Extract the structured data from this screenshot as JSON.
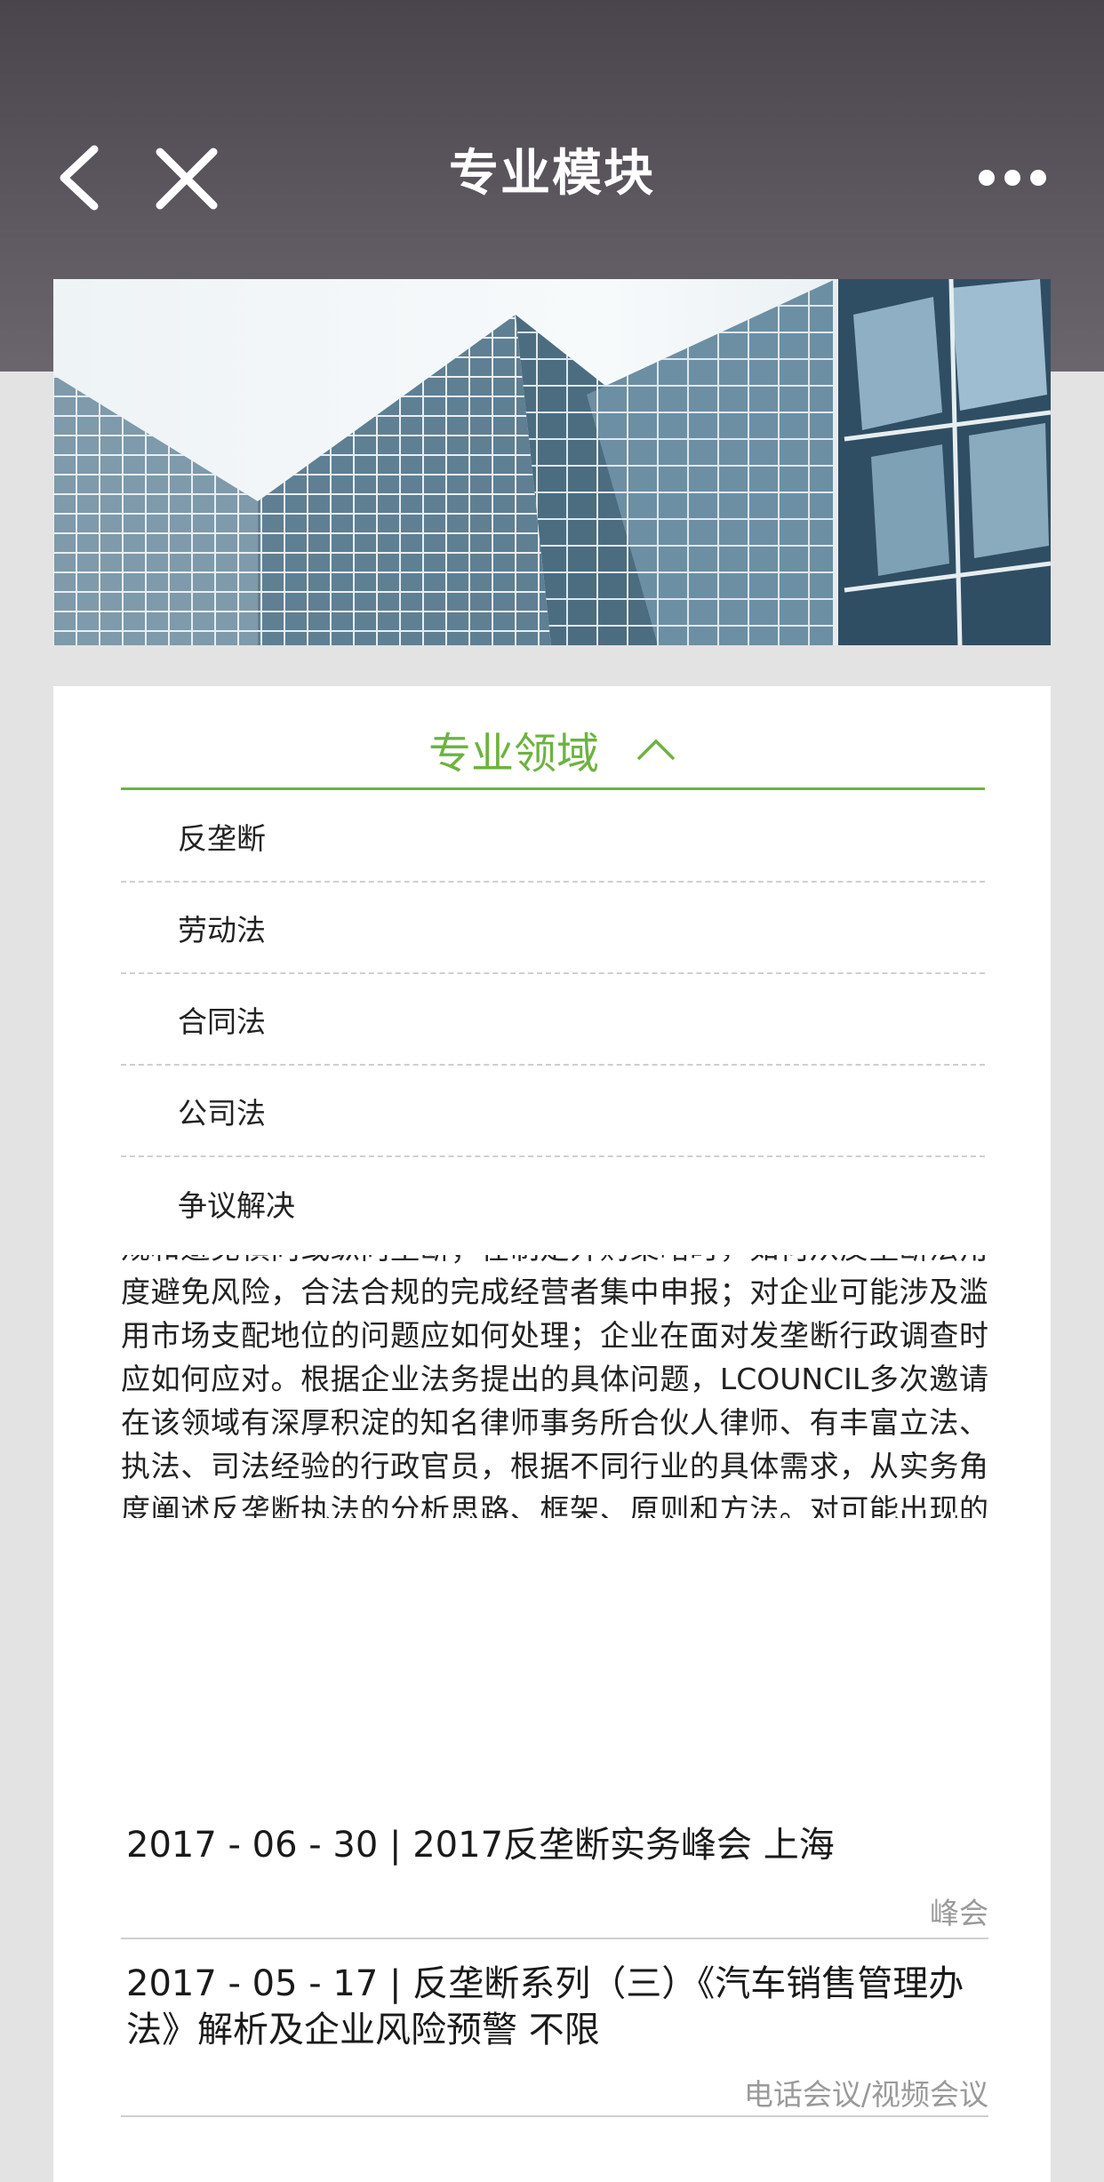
{
  "header": {
    "title": "专业模块"
  },
  "section": {
    "title": "专业领域",
    "items": [
      {
        "label": "反垄断"
      },
      {
        "label": "劳动法"
      },
      {
        "label": "合同法"
      },
      {
        "label": "公司法"
      },
      {
        "label": "争议解决"
      }
    ]
  },
  "description": "规和避免横向或纵向垄断；在制定并购策略时，如何从反垄断法角度避免风险，合法合规的完成经营者集中申报；对企业可能涉及滥用市场支配地位的问题应如何处理；企业在面对发垄断行政调查时应如何应对。根据企业法务提出的具体问题，LCOUNCIL多次邀请在该领域有深厚积淀的知名律师事务所合伙人律师、有丰富立法、执法、司法经验的行政官员，根据不同行业的具体需求，从实务角度阐述反垄断执法的分析思路、框架、原则和方法。对可能出现的反垄断行为进行具体分析，帮助企业法务更好地应对工作中的实务操作问题。此外，LCOUNCIL根据不同企业实际需求，为企业量身定制内部《反垄断法》培训，并可协助企业制定反垄断危机处理指南",
  "events": [
    {
      "title": "2017 - 06 - 30 | 2017反垄断实务峰会  上海",
      "type": "峰会"
    },
    {
      "title": "2017 - 05 - 17 | 反垄断系列（三）《汽车销售管理办法》解析及企业风险预警  不限",
      "type": "电话会议/视频会议"
    }
  ]
}
